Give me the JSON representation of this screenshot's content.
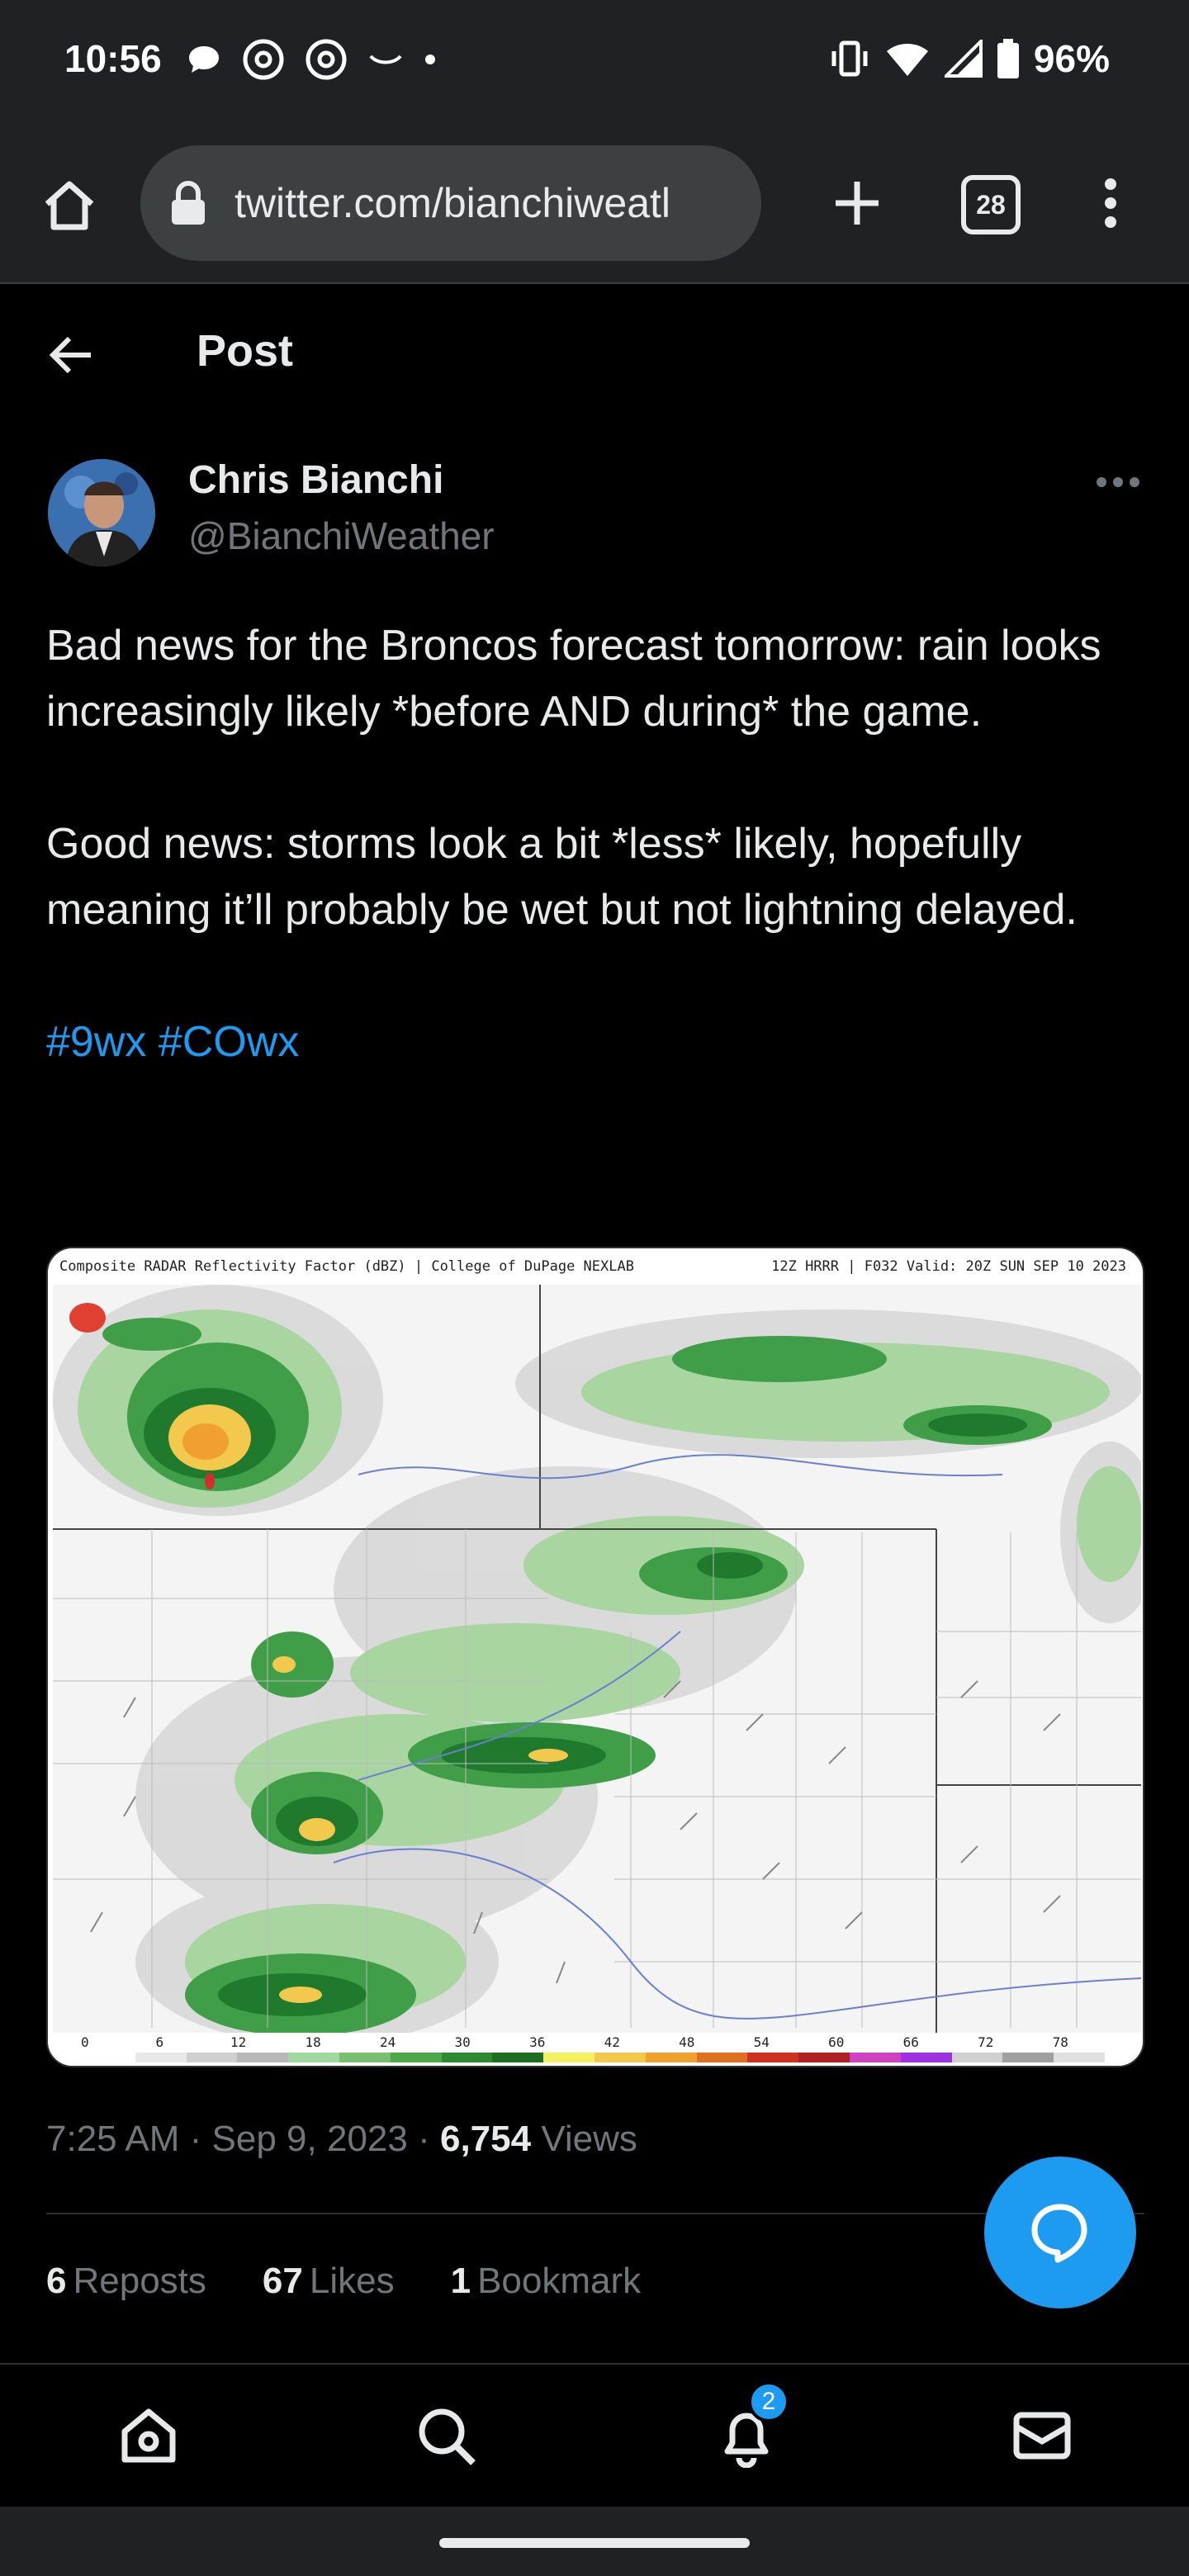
{
  "status_bar": {
    "time": "10:56",
    "battery": "96%",
    "left_icons": [
      "chat-bubble-icon",
      "threads-icon",
      "threads-icon",
      "wave-icon",
      "dot-icon"
    ],
    "right_icons": [
      "vibrate-icon",
      "wifi-icon",
      "signal-icon",
      "battery-icon"
    ]
  },
  "browser": {
    "url": "twitter.com/bianchiweatl",
    "tab_count": "28"
  },
  "post_header": {
    "title": "Post"
  },
  "author": {
    "name": "Chris Bianchi",
    "handle": "@BianchiWeather"
  },
  "tweet": {
    "paragraph1": "Bad news for the Broncos forecast tomorrow: rain looks increasingly likely *before AND during* the game.",
    "paragraph2": "Good news: storms look a bit *less* likely, hopefully meaning it’ll probably be wet but not lightning delayed.",
    "hashtag1": "#9wx",
    "hashtag2": "#COwx"
  },
  "media": {
    "header_left": "Composite RADAR Reflectivity Factor (dBZ) | College of DuPage NEXLAB",
    "header_right": "12Z HRRR | F032 Valid: 20Z SUN SEP 10 2023",
    "scale_labels": [
      "0",
      "6",
      "12",
      "18",
      "24",
      "30",
      "36",
      "42",
      "48",
      "54",
      "60",
      "66",
      "72",
      "78"
    ]
  },
  "meta": {
    "time": "7:25 AM",
    "date": "Sep 9, 2023",
    "views_count": "6,754",
    "views_label": "Views"
  },
  "stats": {
    "reposts_count": "6",
    "reposts_label": "Reposts",
    "likes_count": "67",
    "likes_label": "Likes",
    "bookmarks_count": "1",
    "bookmarks_label": "Bookmark"
  },
  "bottom_nav": {
    "notification_badge": "2"
  },
  "colors": {
    "accent": "#1d9bf0",
    "background": "#000000",
    "text": "#e7e9ea",
    "secondary_text": "#71767b"
  }
}
